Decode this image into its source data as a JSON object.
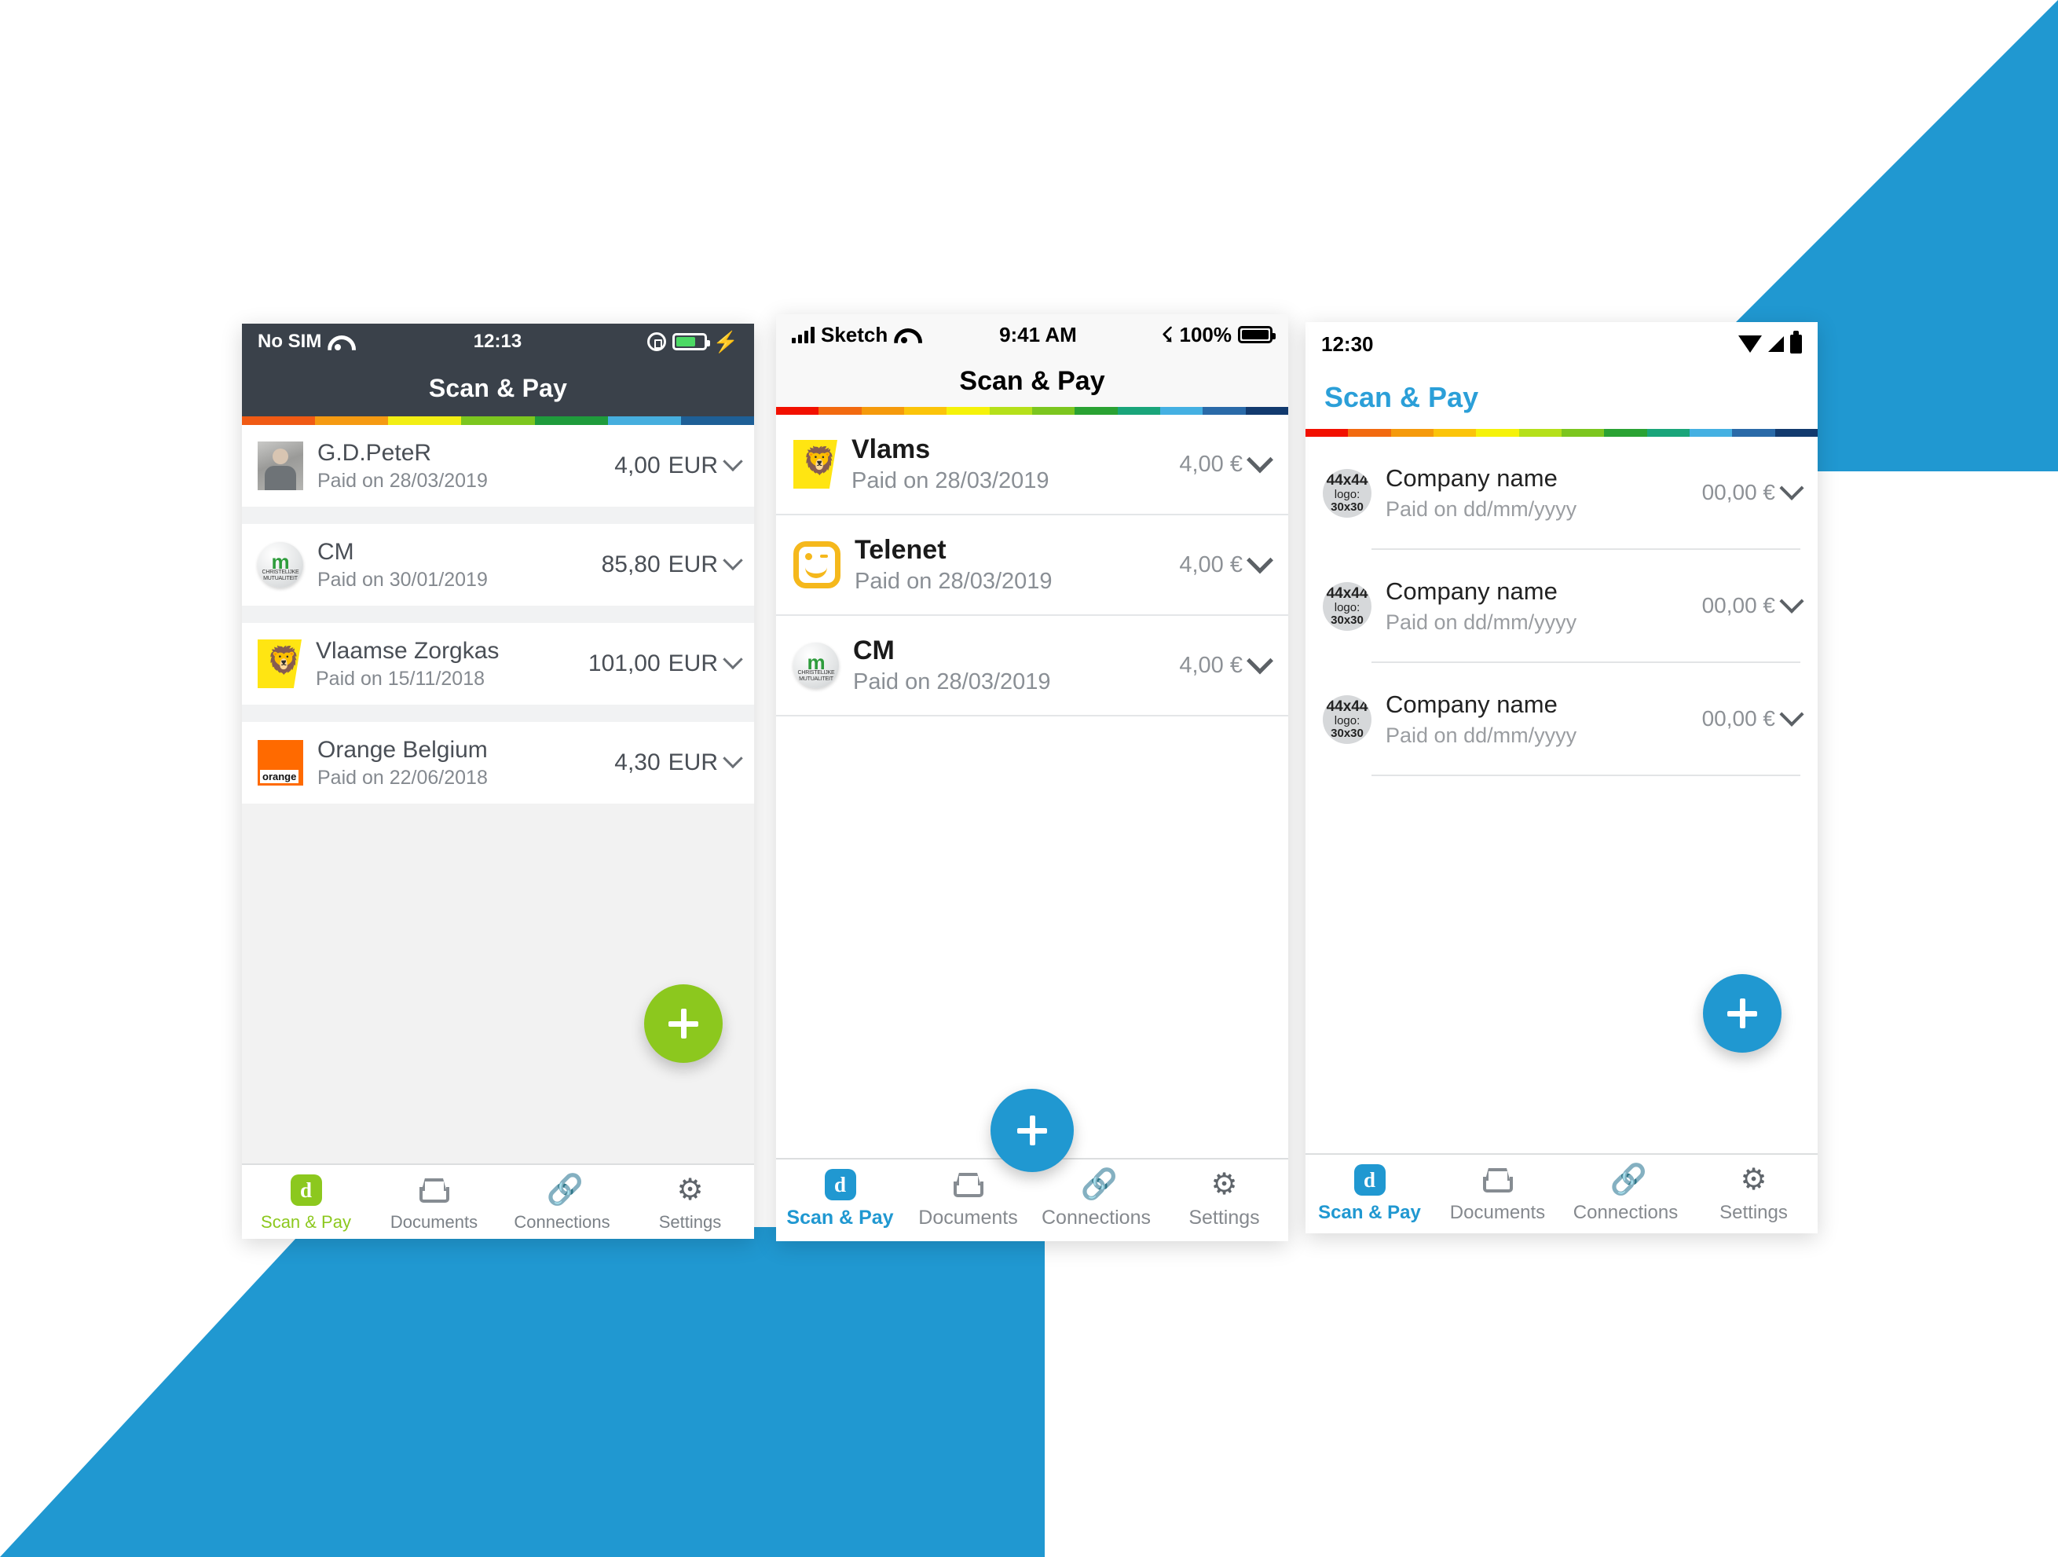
{
  "colors": {
    "brand_blue": "#2098d1",
    "brand_green": "#8cc81e",
    "ios_dark_bar": "#3a414a",
    "muted_text": "#85898e"
  },
  "background": {
    "top_right_shape": "blue-diagonal",
    "bottom_left_shape": "blue-diagonal"
  },
  "rainbow": {
    "phone1": [
      "#f05a14",
      "#f59a12",
      "#f2ee14",
      "#7cc61f",
      "#1f9b3c",
      "#46aede",
      "#1e5f96"
    ],
    "phone2": [
      "#f21000",
      "#f26a10",
      "#f59a0c",
      "#fbc40a",
      "#f5f20a",
      "#b5e01a",
      "#7cc61f",
      "#2aa233",
      "#1aa57a",
      "#44b0e2",
      "#2a6aa8",
      "#123a6e"
    ],
    "phone3": [
      "#f21000",
      "#f26a10",
      "#f59a0c",
      "#fbc40a",
      "#f5f20a",
      "#b5e01a",
      "#7cc61f",
      "#2aa233",
      "#1aa57a",
      "#44b0e2",
      "#2a6aa8",
      "#123a6e"
    ]
  },
  "tabs": {
    "scan_and_pay": "Scan & Pay",
    "documents": "Documents",
    "connections": "Connections",
    "settings": "Settings",
    "scan_icon_letter": "d"
  },
  "fab": {
    "label": "+"
  },
  "phone1": {
    "platform": "ios",
    "statusbar": {
      "carrier": "No SIM",
      "time": "12:13",
      "wifi": "wifi-icon",
      "lock": "rotation-lock-icon",
      "battery": "battery-icon",
      "charging": "⚡"
    },
    "title": "Scan & Pay",
    "rows": [
      {
        "avatar": "peter-photo",
        "name": "G.D.PeteR",
        "date": "Paid on 28/03/2019",
        "amount": "4,00",
        "currency": "EUR"
      },
      {
        "avatar": "cm-logo",
        "name": "CM",
        "date": "Paid on 30/01/2019",
        "amount": "85,80",
        "currency": "EUR"
      },
      {
        "avatar": "vlaams-logo",
        "name": "Vlaamse Zorgkas",
        "date": "Paid on 15/11/2018",
        "amount": "101,00",
        "currency": "EUR"
      },
      {
        "avatar": "orange-logo",
        "name": "Orange Belgium",
        "date": "Paid on 22/06/2018",
        "amount": "4,30",
        "currency": "EUR"
      }
    ],
    "active_tab": "Scan & Pay"
  },
  "phone2": {
    "platform": "ios",
    "statusbar": {
      "carrier": "Sketch",
      "time": "9:41 AM",
      "signal": "signal-bars-icon",
      "wifi": "wifi-icon",
      "bluetooth": "⌁",
      "battery_pct": "100%",
      "battery": "battery-icon"
    },
    "title": "Scan & Pay",
    "rows": [
      {
        "avatar": "vlaams-logo",
        "name": "Vlams",
        "date": "Paid on 28/03/2019",
        "amount": "4,00 €"
      },
      {
        "avatar": "telenet-logo",
        "name": "Telenet",
        "date": "Paid on 28/03/2019",
        "amount": "4,00 €"
      },
      {
        "avatar": "cm-logo",
        "name": "CM",
        "date": "Paid on 28/03/2019",
        "amount": "4,00 €"
      }
    ],
    "active_tab": "Scan & Pay"
  },
  "phone3": {
    "platform": "android",
    "statusbar": {
      "time": "12:30",
      "wifi": "wifi-icon",
      "signal": "signal-icon",
      "battery": "battery-icon"
    },
    "title": "Scan & Pay",
    "rows": [
      {
        "avatar_line1": "44x44",
        "avatar_line2": "logo:",
        "avatar_line3": "30x30",
        "name": "Company name",
        "date": "Paid on dd/mm/yyyy",
        "amount": "00,00 €"
      },
      {
        "avatar_line1": "44x44",
        "avatar_line2": "logo:",
        "avatar_line3": "30x30",
        "name": "Company name",
        "date": "Paid on dd/mm/yyyy",
        "amount": "00,00 €"
      },
      {
        "avatar_line1": "44x44",
        "avatar_line2": "logo:",
        "avatar_line3": "30x30",
        "name": "Company name",
        "date": "Paid on dd/mm/yyyy",
        "amount": "00,00 €"
      }
    ],
    "active_tab": "Scan & Pay"
  }
}
